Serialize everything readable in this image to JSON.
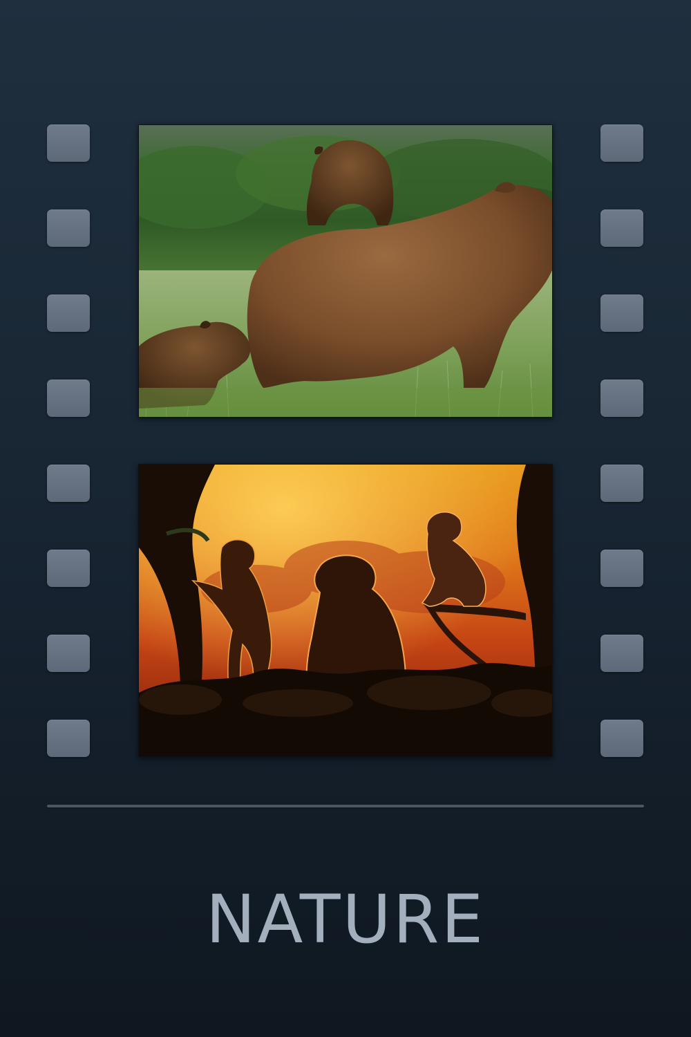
{
  "poster": {
    "title": "NATURE"
  },
  "frames": [
    {
      "name": "bear-family-frame",
      "icon": "brown-bear-with-cubs-photo"
    },
    {
      "name": "monkeys-sunset-frame",
      "icon": "monkeys-jungle-sunset-photo"
    }
  ],
  "film_strip": {
    "sprocket_color": "#6a7686",
    "background_color": "#1a2836",
    "title_color": "#a3afbd"
  }
}
